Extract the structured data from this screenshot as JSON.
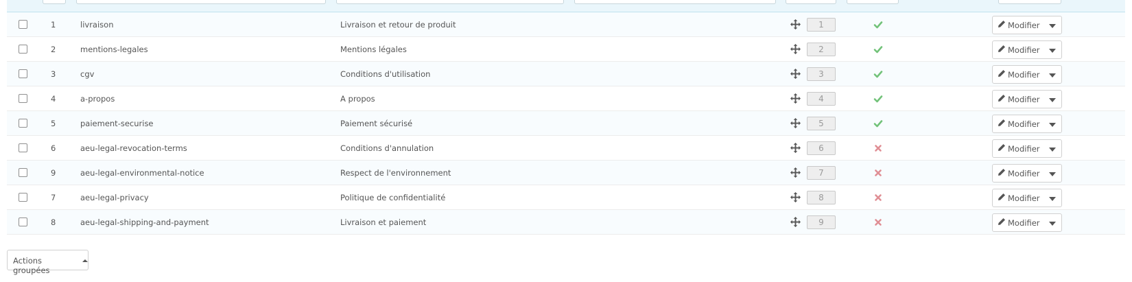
{
  "rows": [
    {
      "id": "1",
      "link_rewrite": "livraison",
      "meta_title": "Livraison et retour de produit",
      "position": "1",
      "active": true
    },
    {
      "id": "2",
      "link_rewrite": "mentions-legales",
      "meta_title": "Mentions légales",
      "position": "2",
      "active": true
    },
    {
      "id": "3",
      "link_rewrite": "cgv",
      "meta_title": "Conditions d'utilisation",
      "position": "3",
      "active": true
    },
    {
      "id": "4",
      "link_rewrite": "a-propos",
      "meta_title": "A propos",
      "position": "4",
      "active": true
    },
    {
      "id": "5",
      "link_rewrite": "paiement-securise",
      "meta_title": "Paiement sécurisé",
      "position": "5",
      "active": true
    },
    {
      "id": "6",
      "link_rewrite": "aeu-legal-revocation-terms",
      "meta_title": "Conditions d'annulation",
      "position": "6",
      "active": false
    },
    {
      "id": "9",
      "link_rewrite": "aeu-legal-environmental-notice",
      "meta_title": "Respect de l'environnement",
      "position": "7",
      "active": false
    },
    {
      "id": "7",
      "link_rewrite": "aeu-legal-privacy",
      "meta_title": "Politique de confidentialité",
      "position": "8",
      "active": false
    },
    {
      "id": "8",
      "link_rewrite": "aeu-legal-shipping-and-payment",
      "meta_title": "Livraison et paiement",
      "position": "9",
      "active": false
    }
  ],
  "row_actions": {
    "edit_label": "Modifier"
  },
  "bulk_actions": {
    "label": "Actions groupées"
  },
  "icons": {
    "drag": "move-icon",
    "enabled": "check-icon",
    "disabled": "cross-icon",
    "edit": "pencil-icon",
    "caret": "caret-down-icon"
  },
  "colors": {
    "enabled": "#72c279",
    "disabled": "#e08f95",
    "filter_bg": "#eaf6fb",
    "row_alt": "#f8fcfe"
  }
}
